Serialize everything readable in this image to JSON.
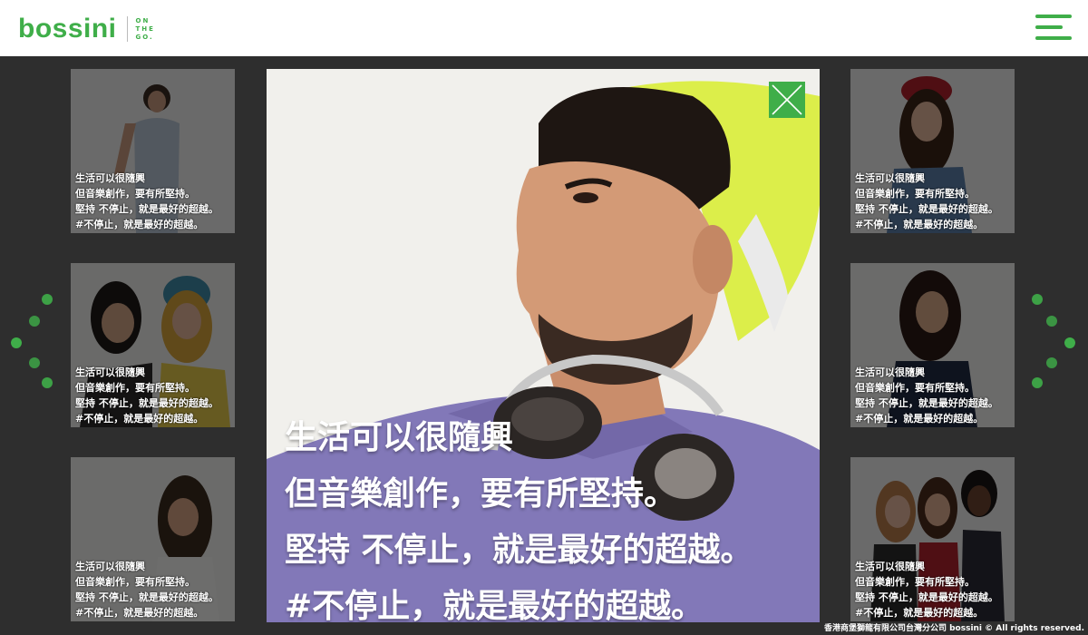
{
  "header": {
    "logo_text": "bossini",
    "tagline": [
      "ON",
      "THE",
      "GO."
    ],
    "menu_icon": "hamburger-menu-icon"
  },
  "colors": {
    "brand_green": "#3fae49",
    "overlay": "#2e2e2e"
  },
  "gallery": {
    "cards": [
      {
        "caption": [
          "生活可以很隨興",
          "但音樂創作，要有所堅持。",
          "堅持 不停止，就是最好的超越。",
          "#不停止，就是最好的超越。"
        ]
      },
      {
        "caption": [
          "生活可以很隨興",
          "但音樂創作，要有所堅持。",
          "堅持 不停止，就是最好的超越。",
          "#不停止，就是最好的超越。"
        ]
      },
      {
        "caption": [
          "生活可以很隨興",
          "但音樂創作，要有所堅持。",
          "堅持 不停止，就是最好的超越。",
          "#不停止，就是最好的超越。"
        ]
      },
      {
        "caption": [
          "生活可以很隨興",
          "但音樂創作，要有所堅持。",
          "堅持 不停止，就是最好的超越。",
          "#不停止，就是最好的超越。"
        ]
      },
      {
        "caption": [
          "生活可以很隨興",
          "但音樂創作，要有所堅持。",
          "堅持 不停止，就是最好的超越。",
          "#不停止，就是最好的超越。"
        ]
      },
      {
        "caption": [
          "生活可以很隨興",
          "但音樂創作，要有所堅持。",
          "堅持 不停止，就是最好的超越。",
          "#不停止，就是最好的超越。"
        ]
      }
    ]
  },
  "modal": {
    "caption": [
      "生活可以很隨興",
      "但音樂創作，要有所堅持。",
      "堅持 不停止，就是最好的超越。",
      "#不停止，就是最好的超越。"
    ],
    "close_icon": "close-icon"
  },
  "nav": {
    "prev_icon": "chevron-left-icon",
    "next_icon": "chevron-right-icon"
  },
  "footer": {
    "copyright": "香港商堡獅龍有限公司台灣分公司 bossini © All rights reserved."
  }
}
